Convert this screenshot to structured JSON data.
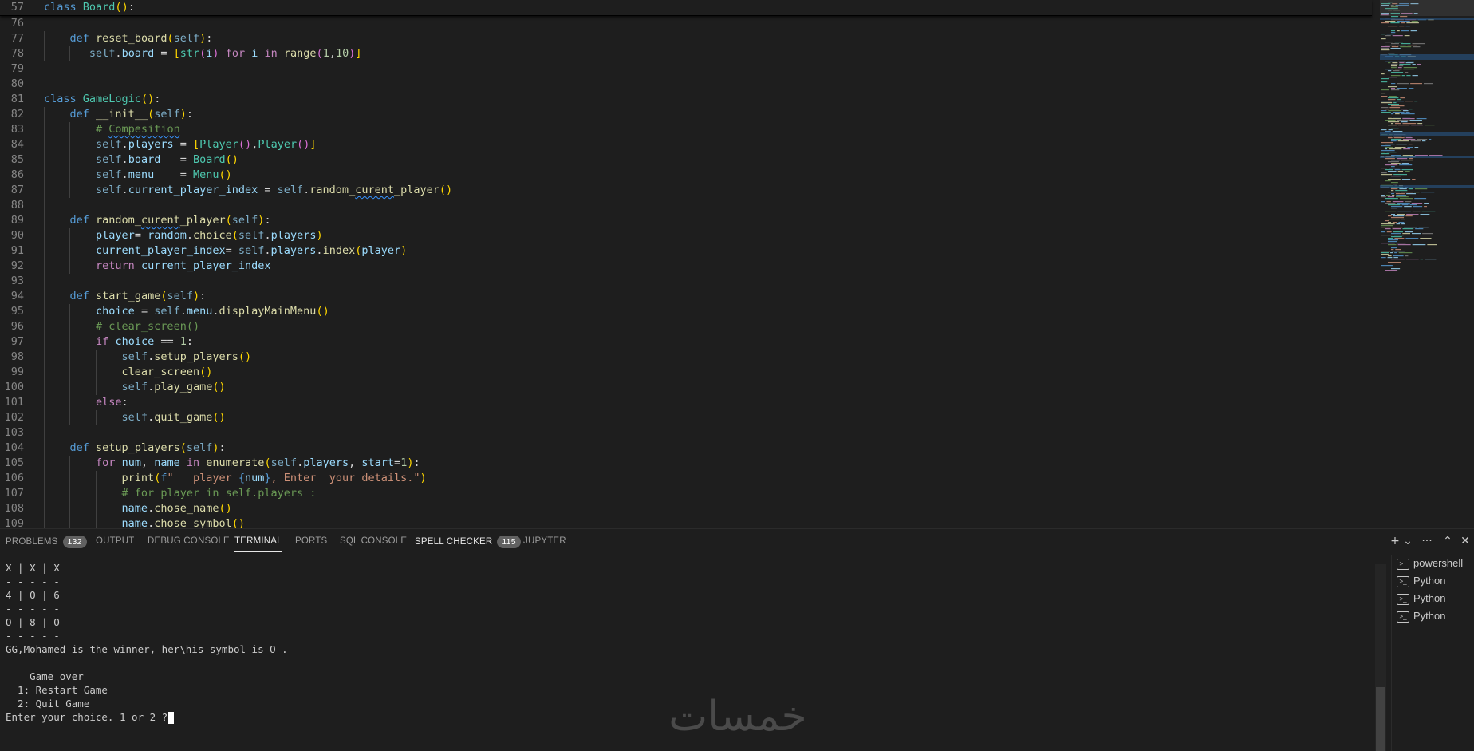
{
  "editor": {
    "lines": [
      {
        "n": "57",
        "sticky": true,
        "guides": 0,
        "tokens": [
          [
            "kw",
            "class"
          ],
          [
            "pl",
            " "
          ],
          [
            "cls",
            "Board"
          ],
          [
            "br1",
            "("
          ],
          [
            "br1",
            ")"
          ],
          [
            "pl",
            ":"
          ]
        ]
      },
      {
        "n": "76",
        "guides": 0,
        "tokens": []
      },
      {
        "n": "77",
        "guides": 1,
        "tokens": [
          [
            "pl",
            "    "
          ],
          [
            "kw",
            "def"
          ],
          [
            "pl",
            " "
          ],
          [
            "fn",
            "reset_board"
          ],
          [
            "br1",
            "("
          ],
          [
            "slf",
            "self"
          ],
          [
            "br1",
            ")"
          ],
          [
            "pl",
            ":"
          ]
        ]
      },
      {
        "n": "78",
        "guides": 2,
        "tokens": [
          [
            "pl",
            "       "
          ],
          [
            "slf",
            "self"
          ],
          [
            "pl",
            "."
          ],
          [
            "var",
            "board"
          ],
          [
            "pl",
            " = "
          ],
          [
            "br1",
            "["
          ],
          [
            "cls",
            "str"
          ],
          [
            "br2",
            "("
          ],
          [
            "var",
            "i"
          ],
          [
            "br2",
            ")"
          ],
          [
            "pl",
            " "
          ],
          [
            "ctl",
            "for"
          ],
          [
            "pl",
            " "
          ],
          [
            "var",
            "i"
          ],
          [
            "pl",
            " "
          ],
          [
            "ctl",
            "in"
          ],
          [
            "pl",
            " "
          ],
          [
            "fn",
            "range"
          ],
          [
            "br2",
            "("
          ],
          [
            "num",
            "1"
          ],
          [
            "pl",
            ","
          ],
          [
            "num",
            "10"
          ],
          [
            "br2",
            ")"
          ],
          [
            "br1",
            "]"
          ]
        ]
      },
      {
        "n": "79",
        "guides": 0,
        "tokens": []
      },
      {
        "n": "80",
        "guides": 0,
        "tokens": []
      },
      {
        "n": "81",
        "guides": 0,
        "tokens": [
          [
            "kw",
            "class"
          ],
          [
            "pl",
            " "
          ],
          [
            "cls",
            "GameLogic"
          ],
          [
            "br1",
            "("
          ],
          [
            "br1",
            ")"
          ],
          [
            "pl",
            ":"
          ]
        ]
      },
      {
        "n": "82",
        "guides": 1,
        "tokens": [
          [
            "pl",
            "    "
          ],
          [
            "kw",
            "def"
          ],
          [
            "pl",
            " "
          ],
          [
            "fn",
            "__init__"
          ],
          [
            "br1",
            "("
          ],
          [
            "slf",
            "self"
          ],
          [
            "br1",
            ")"
          ],
          [
            "pl",
            ":"
          ]
        ]
      },
      {
        "n": "83",
        "guides": 2,
        "tokens": [
          [
            "pl",
            "        "
          ],
          [
            "cmt",
            "# "
          ],
          [
            "cmt squig",
            "Compesition"
          ]
        ]
      },
      {
        "n": "84",
        "guides": 2,
        "tokens": [
          [
            "pl",
            "        "
          ],
          [
            "slf",
            "self"
          ],
          [
            "pl",
            "."
          ],
          [
            "var",
            "players"
          ],
          [
            "pl",
            " = "
          ],
          [
            "br1",
            "["
          ],
          [
            "cls",
            "Player"
          ],
          [
            "br2",
            "("
          ],
          [
            "br2",
            ")"
          ],
          [
            "pl",
            ","
          ],
          [
            "cls",
            "Player"
          ],
          [
            "br2",
            "("
          ],
          [
            "br2",
            ")"
          ],
          [
            "br1",
            "]"
          ]
        ]
      },
      {
        "n": "85",
        "guides": 2,
        "tokens": [
          [
            "pl",
            "        "
          ],
          [
            "slf",
            "self"
          ],
          [
            "pl",
            "."
          ],
          [
            "var",
            "board"
          ],
          [
            "pl",
            "   = "
          ],
          [
            "cls",
            "Board"
          ],
          [
            "br1",
            "("
          ],
          [
            "br1",
            ")"
          ]
        ]
      },
      {
        "n": "86",
        "guides": 2,
        "tokens": [
          [
            "pl",
            "        "
          ],
          [
            "slf",
            "self"
          ],
          [
            "pl",
            "."
          ],
          [
            "var",
            "menu"
          ],
          [
            "pl",
            "    = "
          ],
          [
            "cls",
            "Menu"
          ],
          [
            "br1",
            "("
          ],
          [
            "br1",
            ")"
          ]
        ]
      },
      {
        "n": "87",
        "guides": 2,
        "tokens": [
          [
            "pl",
            "        "
          ],
          [
            "slf",
            "self"
          ],
          [
            "pl",
            "."
          ],
          [
            "var",
            "current_player_index"
          ],
          [
            "pl",
            " = "
          ],
          [
            "slf",
            "self"
          ],
          [
            "pl",
            "."
          ],
          [
            "fn",
            "random_"
          ],
          [
            "fn squig",
            "curent"
          ],
          [
            "fn",
            "_player"
          ],
          [
            "br1",
            "("
          ],
          [
            "br1",
            ")"
          ]
        ]
      },
      {
        "n": "88",
        "guides": 1,
        "tokens": []
      },
      {
        "n": "89",
        "guides": 1,
        "tokens": [
          [
            "pl",
            "    "
          ],
          [
            "kw",
            "def"
          ],
          [
            "pl",
            " "
          ],
          [
            "fn",
            "random_"
          ],
          [
            "fn squig",
            "curent"
          ],
          [
            "fn",
            "_player"
          ],
          [
            "br1",
            "("
          ],
          [
            "slf",
            "self"
          ],
          [
            "br1",
            ")"
          ],
          [
            "pl",
            ":"
          ]
        ]
      },
      {
        "n": "90",
        "guides": 2,
        "tokens": [
          [
            "pl",
            "        "
          ],
          [
            "var",
            "player"
          ],
          [
            "pl",
            "= "
          ],
          [
            "var",
            "random"
          ],
          [
            "pl",
            "."
          ],
          [
            "fn",
            "choice"
          ],
          [
            "br1",
            "("
          ],
          [
            "slf",
            "self"
          ],
          [
            "pl",
            "."
          ],
          [
            "var",
            "players"
          ],
          [
            "br1",
            ")"
          ]
        ]
      },
      {
        "n": "91",
        "guides": 2,
        "tokens": [
          [
            "pl",
            "        "
          ],
          [
            "var",
            "current_player_index"
          ],
          [
            "pl",
            "= "
          ],
          [
            "slf",
            "self"
          ],
          [
            "pl",
            "."
          ],
          [
            "var",
            "players"
          ],
          [
            "pl",
            "."
          ],
          [
            "fn",
            "index"
          ],
          [
            "br1",
            "("
          ],
          [
            "var",
            "player"
          ],
          [
            "br1",
            ")"
          ]
        ]
      },
      {
        "n": "92",
        "guides": 2,
        "tokens": [
          [
            "pl",
            "        "
          ],
          [
            "ctl",
            "return"
          ],
          [
            "pl",
            " "
          ],
          [
            "var",
            "current_player_index"
          ]
        ]
      },
      {
        "n": "93",
        "guides": 1,
        "tokens": []
      },
      {
        "n": "94",
        "guides": 1,
        "tokens": [
          [
            "pl",
            "    "
          ],
          [
            "kw",
            "def"
          ],
          [
            "pl",
            " "
          ],
          [
            "fn",
            "start_game"
          ],
          [
            "br1",
            "("
          ],
          [
            "slf",
            "self"
          ],
          [
            "br1",
            ")"
          ],
          [
            "pl",
            ":"
          ]
        ]
      },
      {
        "n": "95",
        "guides": 2,
        "tokens": [
          [
            "pl",
            "        "
          ],
          [
            "var",
            "choice"
          ],
          [
            "pl",
            " = "
          ],
          [
            "slf",
            "self"
          ],
          [
            "pl",
            "."
          ],
          [
            "var",
            "menu"
          ],
          [
            "pl",
            "."
          ],
          [
            "fn",
            "displayMainMenu"
          ],
          [
            "br1",
            "("
          ],
          [
            "br1",
            ")"
          ]
        ]
      },
      {
        "n": "96",
        "guides": 2,
        "tokens": [
          [
            "pl",
            "        "
          ],
          [
            "cmt",
            "# clear_screen()"
          ]
        ]
      },
      {
        "n": "97",
        "guides": 2,
        "tokens": [
          [
            "pl",
            "        "
          ],
          [
            "ctl",
            "if"
          ],
          [
            "pl",
            " "
          ],
          [
            "var",
            "choice"
          ],
          [
            "pl",
            " == "
          ],
          [
            "num",
            "1"
          ],
          [
            "pl",
            ":"
          ]
        ]
      },
      {
        "n": "98",
        "guides": 3,
        "tokens": [
          [
            "pl",
            "            "
          ],
          [
            "slf",
            "self"
          ],
          [
            "pl",
            "."
          ],
          [
            "fn",
            "setup_players"
          ],
          [
            "br1",
            "("
          ],
          [
            "br1",
            ")"
          ]
        ]
      },
      {
        "n": "99",
        "guides": 3,
        "tokens": [
          [
            "pl",
            "            "
          ],
          [
            "fn",
            "clear_screen"
          ],
          [
            "br1",
            "("
          ],
          [
            "br1",
            ")"
          ]
        ]
      },
      {
        "n": "100",
        "guides": 3,
        "tokens": [
          [
            "pl",
            "            "
          ],
          [
            "slf",
            "self"
          ],
          [
            "pl",
            "."
          ],
          [
            "fn",
            "play_game"
          ],
          [
            "br1",
            "("
          ],
          [
            "br1",
            ")"
          ]
        ]
      },
      {
        "n": "101",
        "guides": 2,
        "tokens": [
          [
            "pl",
            "        "
          ],
          [
            "ctl",
            "else"
          ],
          [
            "pl",
            ":"
          ]
        ]
      },
      {
        "n": "102",
        "guides": 3,
        "tokens": [
          [
            "pl",
            "            "
          ],
          [
            "slf",
            "self"
          ],
          [
            "pl",
            "."
          ],
          [
            "fn",
            "quit_game"
          ],
          [
            "br1",
            "("
          ],
          [
            "br1",
            ")"
          ]
        ]
      },
      {
        "n": "103",
        "guides": 1,
        "tokens": []
      },
      {
        "n": "104",
        "guides": 1,
        "tokens": [
          [
            "pl",
            "    "
          ],
          [
            "kw",
            "def"
          ],
          [
            "pl",
            " "
          ],
          [
            "fn",
            "setup_players"
          ],
          [
            "br1",
            "("
          ],
          [
            "slf",
            "self"
          ],
          [
            "br1",
            ")"
          ],
          [
            "pl",
            ":"
          ]
        ]
      },
      {
        "n": "105",
        "guides": 2,
        "tokens": [
          [
            "pl",
            "        "
          ],
          [
            "ctl",
            "for"
          ],
          [
            "pl",
            " "
          ],
          [
            "var",
            "num"
          ],
          [
            "pl",
            ", "
          ],
          [
            "var",
            "name"
          ],
          [
            "pl",
            " "
          ],
          [
            "ctl",
            "in"
          ],
          [
            "pl",
            " "
          ],
          [
            "fn",
            "enumerate"
          ],
          [
            "br1",
            "("
          ],
          [
            "slf",
            "self"
          ],
          [
            "pl",
            "."
          ],
          [
            "var",
            "players"
          ],
          [
            "pl",
            ", "
          ],
          [
            "var",
            "start"
          ],
          [
            "pl",
            "="
          ],
          [
            "num",
            "1"
          ],
          [
            "br1",
            ")"
          ],
          [
            "pl",
            ":"
          ]
        ]
      },
      {
        "n": "106",
        "guides": 3,
        "tokens": [
          [
            "pl",
            "            "
          ],
          [
            "fn",
            "print"
          ],
          [
            "br1",
            "("
          ],
          [
            "kw",
            "f"
          ],
          [
            "str",
            "\"   player "
          ],
          [
            "kw",
            "{"
          ],
          [
            "var",
            "num"
          ],
          [
            "kw",
            "}"
          ],
          [
            "str",
            ", Enter  your details.\""
          ],
          [
            "br1",
            ")"
          ]
        ]
      },
      {
        "n": "107",
        "guides": 3,
        "tokens": [
          [
            "pl",
            "            "
          ],
          [
            "cmt",
            "# for player in self.players :"
          ]
        ]
      },
      {
        "n": "108",
        "guides": 3,
        "tokens": [
          [
            "pl",
            "            "
          ],
          [
            "var",
            "name"
          ],
          [
            "pl",
            "."
          ],
          [
            "fn",
            "chose_name"
          ],
          [
            "br1",
            "("
          ],
          [
            "br1",
            ")"
          ]
        ]
      },
      {
        "n": "109",
        "guides": 3,
        "tokens": [
          [
            "pl",
            "            "
          ],
          [
            "var",
            "name"
          ],
          [
            "pl",
            "."
          ],
          [
            "fn",
            "chose_symbol"
          ],
          [
            "br1",
            "("
          ],
          [
            "br1",
            ")"
          ]
        ]
      }
    ]
  },
  "panel": {
    "tabs": [
      {
        "label": "PROBLEMS",
        "badge": "132"
      },
      {
        "label": "OUTPUT"
      },
      {
        "label": "DEBUG CONSOLE"
      },
      {
        "label": "TERMINAL",
        "active": true
      },
      {
        "label": "PORTS"
      },
      {
        "label": "SQL CONSOLE"
      },
      {
        "label": "SPELL CHECKER",
        "badge": "115"
      },
      {
        "label": "JUPYTER"
      }
    ],
    "actions": [
      "+",
      "⌄",
      "···",
      "⌃",
      "✕"
    ]
  },
  "terminal": {
    "lines": [
      "X | X | X",
      "- - - - -",
      "4 | O | 6",
      "- - - - -",
      "O | 8 | O",
      "- - - - -",
      "GG,Mohamed is the winner, her\\his symbol is O .",
      "",
      "    Game over",
      "  1: Restart Game",
      "  2: Quit Game"
    ],
    "prompt": "Enter your choice. 1 or 2 ?",
    "instances": [
      "powershell",
      "Python",
      "Python",
      "Python"
    ]
  },
  "watermark": {
    "text": "خمسات"
  }
}
